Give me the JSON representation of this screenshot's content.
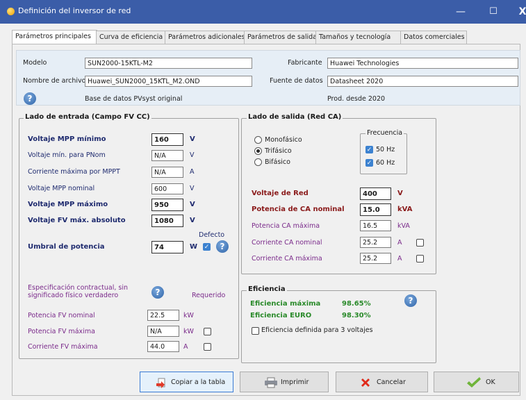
{
  "window": {
    "title": "Definición del inversor de red"
  },
  "tabs": [
    "Parámetros principales",
    "Curva de eficiencia",
    "Parámetros adicionales",
    "Parámetros de salida",
    "Tamaños y tecnología",
    "Datos comerciales"
  ],
  "info": {
    "model_label": "Modelo",
    "model": "SUN2000-15KTL-M2",
    "filename_label": "Nombre de archivo",
    "filename": "Huawei_SUN2000_15KTL_M2.OND",
    "manufacturer_label": "Fabricante",
    "manufacturer": "Huawei Technologies",
    "source_label": "Fuente de datos",
    "source": "Datasheet 2020",
    "db_text": "Base de datos PVsyst original",
    "prod_text": "Prod. desde 2020"
  },
  "input": {
    "title": "Lado de entrada (Campo FV CC)",
    "mpp_min_label": "Voltaje MPP mínimo",
    "mpp_min": "160",
    "mpp_min_unit": "V",
    "vmin_pnom_label": "Voltaje mín. para PNom",
    "vmin_pnom": "N/A",
    "vmin_pnom_unit": "V",
    "imax_mppt_label": "Corriente máxima por MPPT",
    "imax_mppt": "N/A",
    "imax_mppt_unit": "A",
    "mpp_nom_label": "Voltaje MPP nominal",
    "mpp_nom": "600",
    "mpp_nom_unit": "V",
    "mpp_max_label": "Voltaje MPP máximo",
    "mpp_max": "950",
    "mpp_max_unit": "V",
    "vabs_label": "Voltaje FV máx. absoluto",
    "vabs": "1080",
    "vabs_unit": "V",
    "default_label": "Defecto",
    "threshold_label": "Umbral de potencia",
    "threshold": "74",
    "threshold_unit": "W",
    "contract_text_1": "Especificación contractual, sin",
    "contract_text_2": "significado físico verdadero",
    "required_label": "Requerido",
    "pv_nom_label": "Potencia FV nominal",
    "pv_nom": "22.5",
    "pv_nom_unit": "kW",
    "pv_max_label": "Potencia FV máxima",
    "pv_max": "N/A",
    "pv_max_unit": "kW",
    "ipv_max_label": "Corriente FV máxima",
    "ipv_max": "44.0",
    "ipv_max_unit": "A"
  },
  "output": {
    "title": "Lado de salida (Red CA)",
    "mono": "Monofásico",
    "tri": "Trifásico",
    "bi": "Bifásico",
    "freq_title": "Frecuencia",
    "f50": "50 Hz",
    "f60": "60 Hz",
    "grid_v_label": "Voltaje de Red",
    "grid_v": "400",
    "grid_v_unit": "V",
    "ac_nom_label": "Potencia de CA nominal",
    "ac_nom": "15.0",
    "ac_nom_unit": "kVA",
    "ac_max_label": "Potencia CA máxima",
    "ac_max": "16.5",
    "ac_max_unit": "kVA",
    "i_nom_label": "Corriente CA nominal",
    "i_nom": "25.2",
    "i_nom_unit": "A",
    "i_max_label": "Corriente CA máxima",
    "i_max": "25.2",
    "i_max_unit": "A"
  },
  "efficiency": {
    "title": "Eficiencia",
    "max_label": "Eficiencia máxima",
    "max": "98.65%",
    "euro_label": "Eficiencia EURO",
    "euro": "98.30%",
    "three_v_label": "Eficiencia definida para 3 voltajes"
  },
  "buttons": {
    "copy": "Copiar a la tabla",
    "print": "Imprimir",
    "cancel": "Cancelar",
    "ok": "OK"
  }
}
